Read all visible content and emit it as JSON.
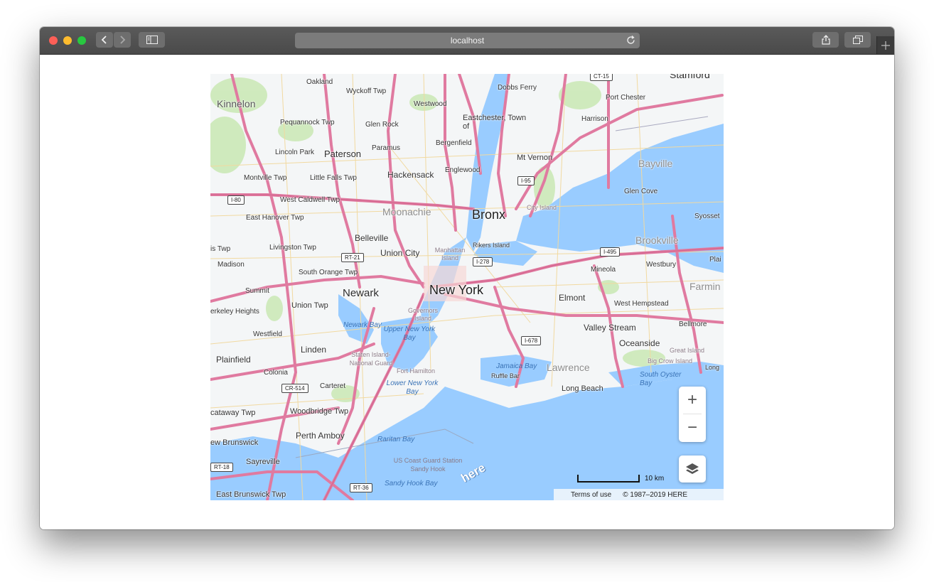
{
  "browser": {
    "url": "localhost",
    "back_icon": "chevron-left-icon",
    "forward_icon": "chevron-right-icon",
    "sidebar_icon": "sidebar-icon",
    "reload_icon": "reload-icon",
    "share_icon": "share-icon",
    "tabs_icon": "tabs-overview-icon",
    "new_tab_icon": "plus-icon"
  },
  "map": {
    "labels": {
      "oakland": "Oakland",
      "wyckoff": "Wyckoff Twp",
      "dobbs": "Dobbs Ferry",
      "stamford": "Stamford",
      "kinnelon": "Kinnelon",
      "westwood": "Westwood",
      "portchester": "Port Chester",
      "eastchester": "Eastchester, Town of",
      "harrison": "Harrison",
      "pequannock": "Pequannock Twp",
      "glenrock": "Glen Rock",
      "paramus": "Paramus",
      "bergenfield": "Bergenfield",
      "lincolnpark": "Lincoln Park",
      "paterson": "Paterson",
      "mtvernon": "Mt Vernon",
      "bayville": "Bayville",
      "montville": "Montville Twp",
      "littlefalls": "Little Falls Twp",
      "hackensack": "Hackensack",
      "englewood": "Englewood",
      "glencove": "Glen Cove",
      "westcaldwell": "West Caldwell Twp",
      "cityisland": "City Island",
      "moonachie": "Moonachie",
      "bronx": "Bronx",
      "easthanover": "East Hanover Twp",
      "syosset": "Syosset",
      "belleville": "Belleville",
      "brookville": "Brookville",
      "istwp": "is Twp",
      "livingston": "Livingston Twp",
      "manhattan": "Manhattan Island",
      "rikers": "Rikers Island",
      "unioncity": "Union City",
      "madison": "Madison",
      "westbury": "Westbury",
      "plai": "Plai",
      "mineola": "Mineola",
      "southorange": "South Orange Twp",
      "newyork": "New York",
      "summit": "Summit",
      "newark": "Newark",
      "elmont": "Elmont",
      "farmin": "Farmin",
      "berkeley": "erkeley Heights",
      "uniontwp": "Union Twp",
      "governors": "Governors Island",
      "westhempstead": "West Hempstead",
      "newarkbay": "Newark Bay",
      "upperbay": "Upper New York Bay",
      "bellmore": "Bellmore",
      "westfield": "Westfield",
      "valleystream": "Valley Stream",
      "oceanside": "Oceanside",
      "linden": "Linden",
      "statenisland": "Staten Island-National Guard",
      "greatisland": "Great Island",
      "plainfield": "Plainfield",
      "jamaicabay": "Jamaica Bay",
      "bigcrow": "Big Crow Island",
      "colonia": "Colonia",
      "forthamilton": "Fort Hamilton",
      "ruffle": "Ruffle Bar",
      "lawrence": "Lawrence",
      "southoyster": "South Oyster Bay",
      "long": "Long",
      "carteret": "Carteret",
      "lowerbay": "Lower New York Bay",
      "longbeach": "Long Beach",
      "cataway": "cataway Twp",
      "woodbridge": "Woodbridge Twp",
      "perthamboy": "Perth Amboy",
      "raritan": "Raritan Bay",
      "newbrunswick": "ew Brunswick",
      "coastguard": "US Coast Guard Station Sandy Hook",
      "sayreville": "Sayreville",
      "sandyhook": "Sandy Hook Bay",
      "eastbrunswick": "East Brunswick Twp"
    },
    "shields": {
      "ct15": "CT-15",
      "i95": "I-95",
      "i80": "I-80",
      "i495": "I-495",
      "rt21": "RT-21",
      "i278": "I-278",
      "i678": "I-678",
      "cr514": "CR-514",
      "rt18": "RT-18",
      "rt36": "RT-36"
    },
    "zoom_in_label": "+",
    "zoom_out_label": "−",
    "layers_icon": "layers-icon",
    "scale_label": "10 km",
    "terms": "Terms of use",
    "copyright": "© 1987–2019 HERE",
    "logo_text": "here"
  },
  "colors": {
    "water": "#99ccff",
    "land": "#f4f6f7",
    "park": "#c9e8b4",
    "highway": "#e07aa0",
    "minor_road": "#f1d9a0"
  }
}
